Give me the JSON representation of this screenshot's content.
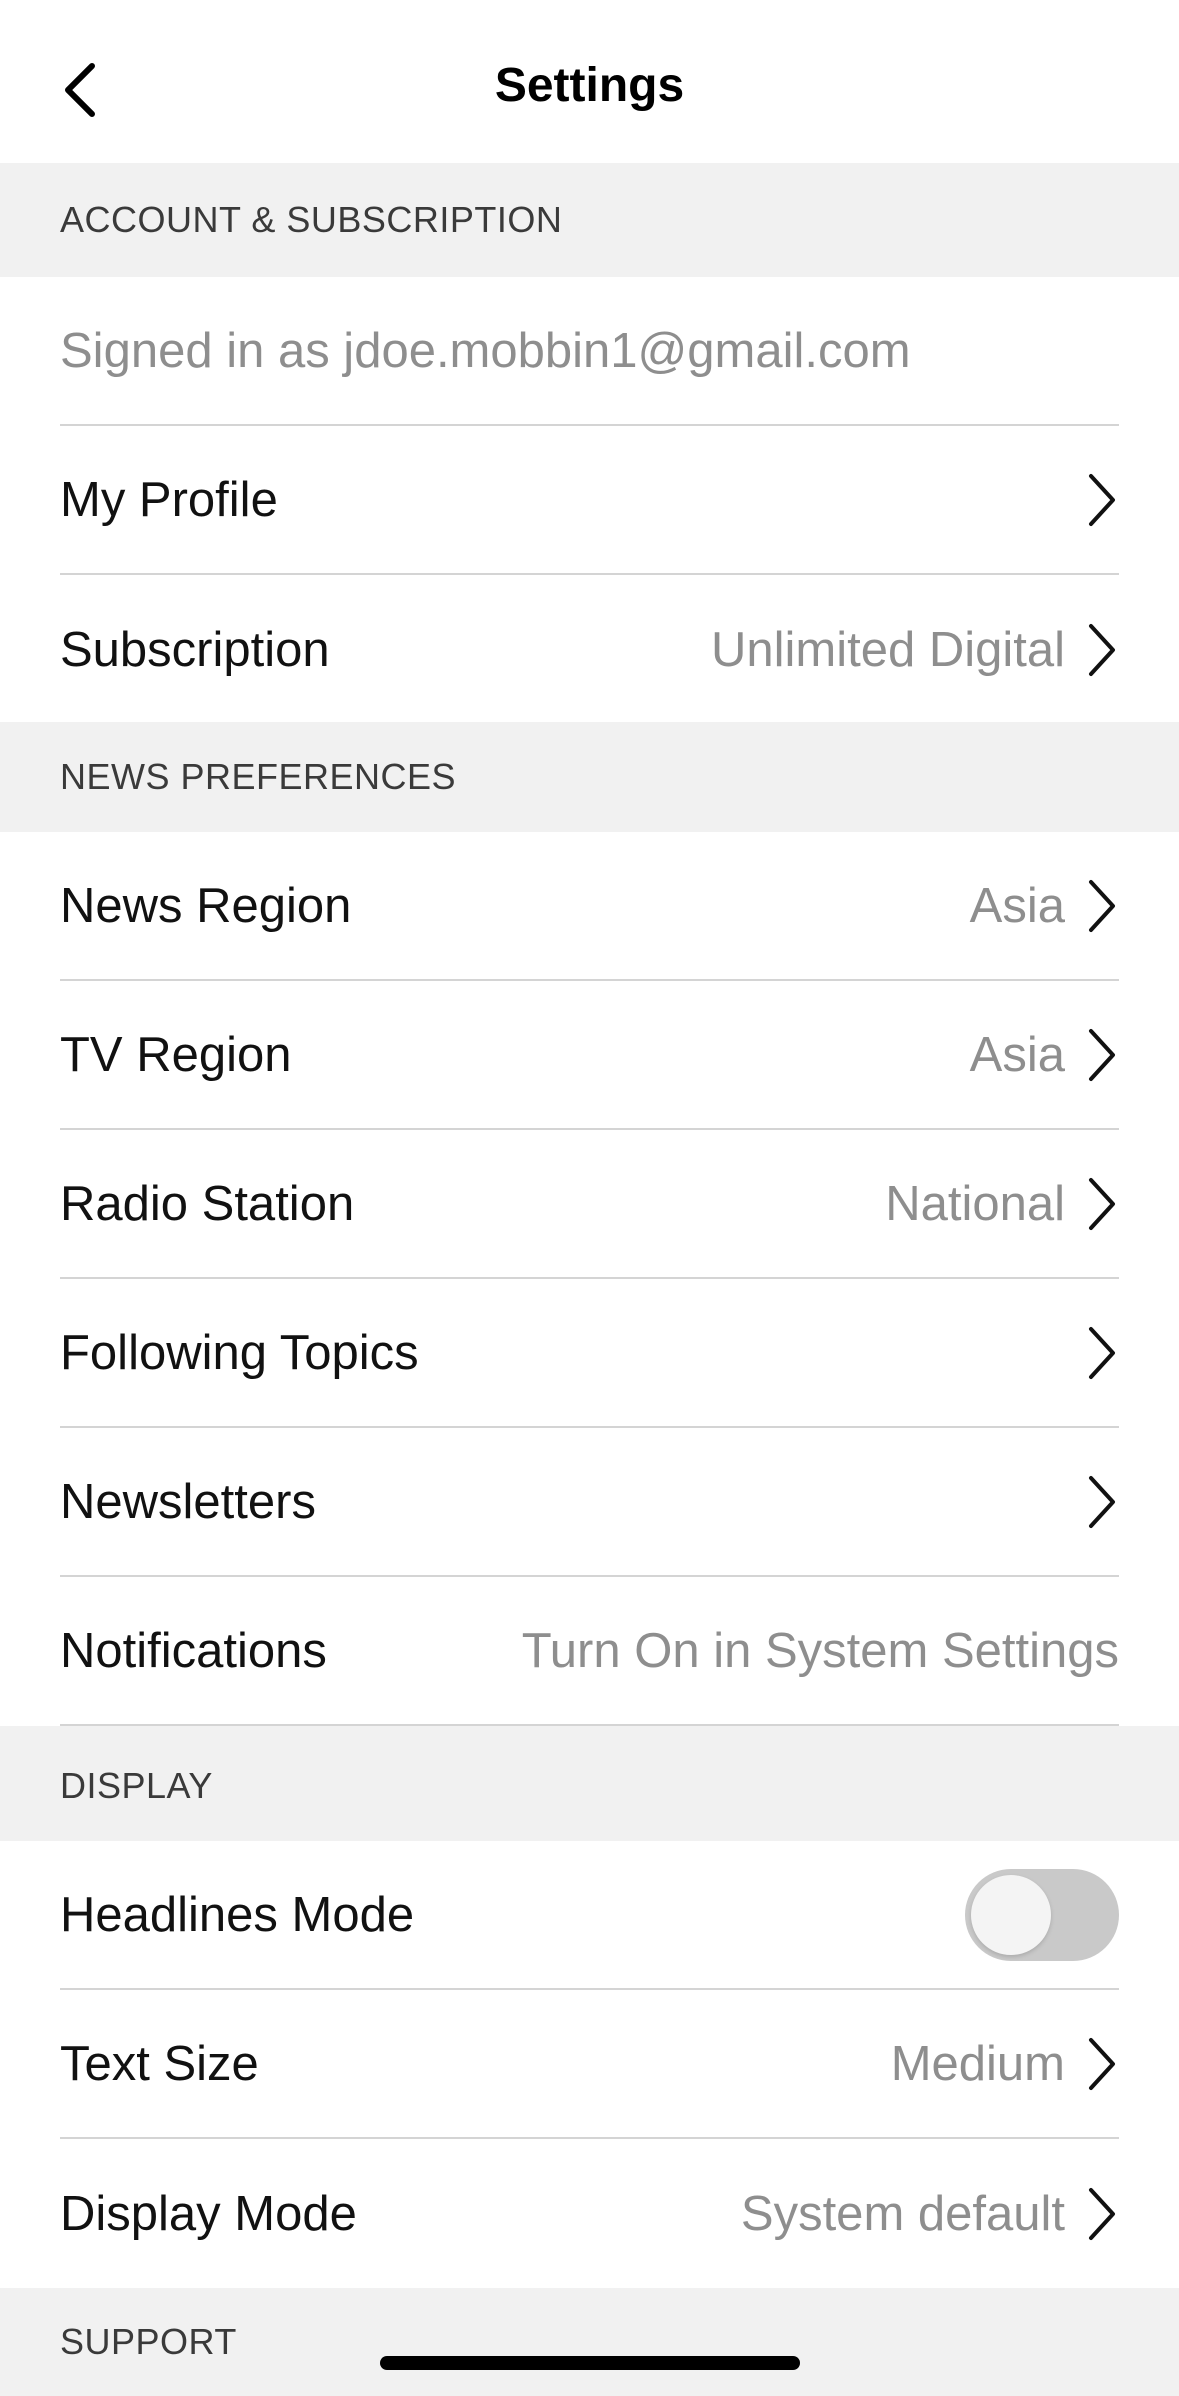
{
  "nav": {
    "title": "Settings",
    "back_icon": "chevron-left-icon"
  },
  "sections": {
    "account": {
      "header": "ACCOUNT & SUBSCRIPTION",
      "signed_in_text": "Signed in as jdoe.mobbin1@gmail.com",
      "my_profile_label": "My Profile",
      "subscription_label": "Subscription",
      "subscription_value": "Unlimited Digital"
    },
    "news": {
      "header": "NEWS PREFERENCES",
      "news_region_label": "News Region",
      "news_region_value": "Asia",
      "tv_region_label": "TV Region",
      "tv_region_value": "Asia",
      "radio_station_label": "Radio Station",
      "radio_station_value": "National",
      "following_topics_label": "Following Topics",
      "newsletters_label": "Newsletters",
      "notifications_label": "Notifications",
      "notifications_value": "Turn On in System Settings"
    },
    "display": {
      "header": "DISPLAY",
      "headlines_mode_label": "Headlines Mode",
      "headlines_mode_on": false,
      "text_size_label": "Text Size",
      "text_size_value": "Medium",
      "display_mode_label": "Display Mode",
      "display_mode_value": "System default"
    },
    "support": {
      "header": "SUPPORT"
    }
  },
  "colors": {
    "background": "#ffffff",
    "section_header_bg": "#f1f1f1",
    "secondary_text": "#8e8e8e",
    "divider": "#d4d4d4",
    "toggle_off": "#c9c9c9"
  },
  "icons": {
    "row_chevron": "chevron-right-icon"
  }
}
